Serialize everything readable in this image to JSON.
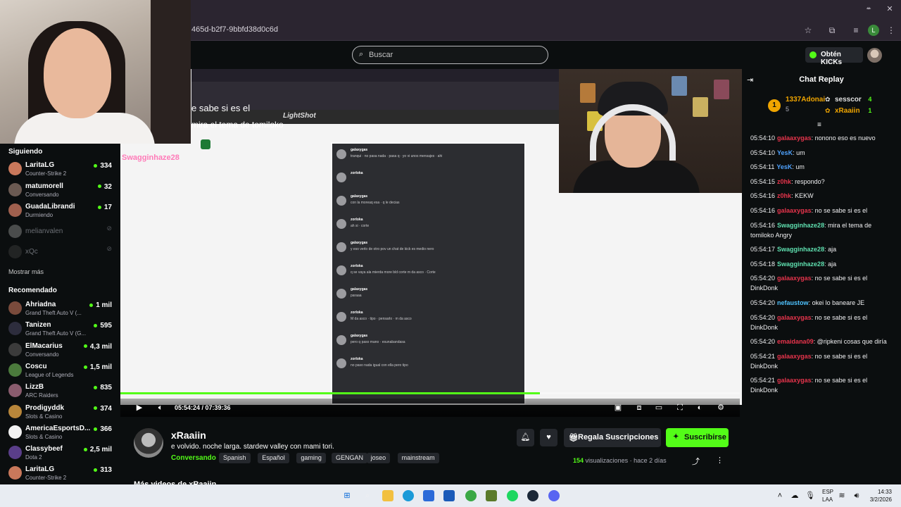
{
  "browser": {
    "url": "465d-b2f7-9bbfd38d0c6d",
    "profile_initial": "L"
  },
  "header": {
    "search_placeholder": "Buscar",
    "get_kicks_label": "Obtén KICKs"
  },
  "sidebar": {
    "following_title": "Siguiendo",
    "following": [
      {
        "name": "LaritaLG",
        "category": "Counter-Strike 2",
        "viewers": "334",
        "avatar_color": "#c9785b",
        "offline": false
      },
      {
        "name": "matumorell",
        "category": "Conversando",
        "viewers": "32",
        "avatar_color": "#6b5a52",
        "offline": false
      },
      {
        "name": "GuadaLibrandi",
        "category": "Durmiendo",
        "viewers": "17",
        "avatar_color": "#a0604e",
        "offline": false
      },
      {
        "name": "melianvalen",
        "category": "",
        "viewers": "",
        "avatar_color": "#8a8a8a",
        "offline": true
      },
      {
        "name": "xQc",
        "category": "",
        "viewers": "",
        "avatar_color": "#3a3a3a",
        "offline": true
      }
    ],
    "show_more": "Mostrar más",
    "recommended_title": "Recomendado",
    "recommended": [
      {
        "name": "Ahriadna",
        "category": "Grand Theft Auto V (...",
        "viewers": "1 mil",
        "avatar_color": "#7a4b3c"
      },
      {
        "name": "Tanizen",
        "category": "Grand Theft Auto V (G...",
        "viewers": "595",
        "avatar_color": "#2d2d3d"
      },
      {
        "name": "ElMacarius",
        "category": "Conversando",
        "viewers": "4,3 mil",
        "avatar_color": "#3b3b3b"
      },
      {
        "name": "Coscu",
        "category": "League of Legends",
        "viewers": "1,5 mil",
        "avatar_color": "#4b7a3c"
      },
      {
        "name": "LizzB",
        "category": "ARC Raiders",
        "viewers": "835",
        "avatar_color": "#8a5c6e"
      },
      {
        "name": "Prodigyddk",
        "category": "Slots & Casino",
        "viewers": "374",
        "avatar_color": "#b8863a"
      },
      {
        "name": "AmericaEsportsD...",
        "category": "Slots & Casino",
        "viewers": "366",
        "avatar_color": "#f2f2f2"
      },
      {
        "name": "Classybeef",
        "category": "Dota 2",
        "viewers": "2,5 mil",
        "avatar_color": "#5a3e8a"
      },
      {
        "name": "LaritaLG",
        "category": "Counter-Strike 2",
        "viewers": "313",
        "avatar_color": "#c9785b"
      }
    ]
  },
  "video": {
    "overlay_line1": "e sabe si es el",
    "overlay_line2": "mira el tema de tomiloko",
    "overlay_user": "Swagginhaze28",
    "lightshot": "LightShot",
    "progress_fraction": 0.1232,
    "time": "05:54:24 / 07:39:36",
    "chat_image_rows": [
      {
        "user": "galaxygas",
        "text": "tranqui · no pasa nada · pasa q · yo vi unos mensajes · ahi"
      },
      {
        "user": "zorloka",
        "text": ""
      },
      {
        "user": "galaxygas",
        "text": "con la moreaq esa · q le decias"
      },
      {
        "user": "zorloka",
        "text": "ah si · corte"
      },
      {
        "user": "galaxygas",
        "text": "y eso verlo de otro pov un chat de kick es medio nero"
      },
      {
        "user": "zorloka",
        "text": "q se vaya ala mierda more bld corte m da asco · Corte"
      },
      {
        "user": "galaxygas",
        "text": "paraaa"
      },
      {
        "user": "zorloka",
        "text": "M da asco · tipo · pensarlo · m da asco"
      },
      {
        "user": "galaxygas",
        "text": "pero q paso mano · esunabandasa"
      },
      {
        "user": "zorloka",
        "text": "no paso nada igual con ella pero tipo"
      }
    ]
  },
  "channel": {
    "name": "xRaaiin",
    "title": "e volvido. noche larga. stardew valley con mami tori.",
    "category": "Conversando",
    "tags": [
      "Spanish",
      "Español",
      "gaming",
      "GENGAN",
      "joseo",
      "mainstream"
    ],
    "gift_label": "Regala Suscripciones",
    "subscribe_label": "Suscribirse",
    "views_count": "154",
    "views_label": "visualizaciones",
    "ago": "hace 2 días",
    "more_videos": "Más videos de xRaaiin"
  },
  "chat": {
    "title": "Chat Replay",
    "leaderboard": [
      {
        "name": "1337Adonai",
        "count": "5",
        "color": "#f0a500"
      },
      {
        "name": "sesscor",
        "count": "4",
        "color": "#e0e0e0"
      },
      {
        "name": "xRaaiin",
        "count": "1",
        "color": "#f0a500"
      }
    ],
    "messages": [
      {
        "ts": "05:54:10",
        "user": "galaaxygas",
        "color": "#e8344c",
        "text": ": nonono eso es nuevo"
      },
      {
        "ts": "05:54:10",
        "user": "YesK",
        "color": "#4fa3ff",
        "text": ": um"
      },
      {
        "ts": "05:54:11",
        "user": "YesK",
        "color": "#4fa3ff",
        "text": ": um"
      },
      {
        "ts": "05:54:15",
        "user": "z0hk",
        "color": "#e8344c",
        "text": ": respondo?"
      },
      {
        "ts": "05:54:16",
        "user": "z0hk",
        "color": "#e8344c",
        "text": ": KEKW"
      },
      {
        "ts": "05:54:16",
        "user": "galaaxygas",
        "color": "#e8344c",
        "text": ": no se sabe si es el"
      },
      {
        "ts": "05:54:16",
        "user": "Swagginhaze28",
        "color": "#5fe0b0",
        "text": ": mira el tema de tomiloko Angry"
      },
      {
        "ts": "05:54:17",
        "user": "Swagginhaze28",
        "color": "#5fe0b0",
        "text": ": aja"
      },
      {
        "ts": "05:54:18",
        "user": "Swagginhaze28",
        "color": "#5fe0b0",
        "text": ": aja"
      },
      {
        "ts": "05:54:20",
        "user": "galaaxygas",
        "color": "#e8344c",
        "text": ": no se sabe si es el DinkDonk"
      },
      {
        "ts": "05:54:20",
        "user": "nefaustow",
        "color": "#4fc3ff",
        "text": ": okei lo baneare JE"
      },
      {
        "ts": "05:54:20",
        "user": "galaaxygas",
        "color": "#e8344c",
        "text": ": no se sabe si es el DinkDonk"
      },
      {
        "ts": "05:54:20",
        "user": "emaidana09",
        "color": "#e8344c",
        "text": ": @ripkeni cosas que diría"
      },
      {
        "ts": "05:54:21",
        "user": "galaaxygas",
        "color": "#e8344c",
        "text": ": no se sabe si es el DinkDonk"
      },
      {
        "ts": "05:54:21",
        "user": "galaaxygas",
        "color": "#e8344c",
        "text": ": no se sabe si es el DinkDonk"
      }
    ]
  },
  "taskbar": {
    "lang_top": "ESP",
    "lang_bottom": "LAA",
    "time": "14:33",
    "date": "3/2/2026"
  }
}
